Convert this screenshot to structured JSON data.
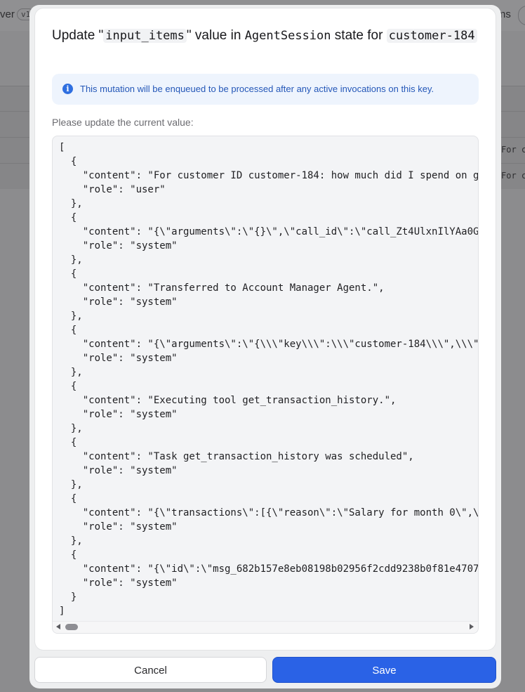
{
  "background": {
    "top_left_text": "ver",
    "version_badge": "v1",
    "top_right_text": "ns",
    "row_cells": [
      "For c",
      "For c"
    ]
  },
  "dialog": {
    "title_prefix": "Update \"",
    "key_name": "input_items",
    "title_mid": "\" value in",
    "entity": "AgentSession",
    "title_suffix": "state for",
    "key_value": "customer-184",
    "info_text": "This mutation will be enqueued to be processed after any active invocations on this key.",
    "field_label": "Please update the current value:",
    "editor_value": "[\n  {\n    \"content\": \"For customer ID customer-184: how much did I spend on ga\n    \"role\": \"user\"\n  },\n  {\n    \"content\": \"{\\\"arguments\\\":\\\"{}\\\",\\\"call_id\\\":\\\"call_Zt4UlxnIlYAa0G\n    \"role\": \"system\"\n  },\n  {\n    \"content\": \"Transferred to Account Manager Agent.\",\n    \"role\": \"system\"\n  },\n  {\n    \"content\": \"{\\\"arguments\\\":\\\"{\\\\\\\"key\\\\\\\":\\\\\\\"customer-184\\\\\\\",\\\\\\\"\n    \"role\": \"system\"\n  },\n  {\n    \"content\": \"Executing tool get_transaction_history.\",\n    \"role\": \"system\"\n  },\n  {\n    \"content\": \"Task get_transaction_history was scheduled\",\n    \"role\": \"system\"\n  },\n  {\n    \"content\": \"{\\\"transactions\\\":[{\\\"reason\\\":\\\"Salary for month 0\\\",\\\n    \"role\": \"system\"\n  },\n  {\n    \"content\": \"{\\\"id\\\":\\\"msg_682b157e8eb08198b02956f2cdd9238b0f81e4707\n    \"role\": \"system\"\n  }\n]",
    "cancel_label": "Cancel",
    "save_label": "Save"
  },
  "colors": {
    "primary": "#2a62e6",
    "info_background": "#eef4fd",
    "info_text": "#2457b8",
    "overlay": "#8c8c8e"
  },
  "icons": {
    "info": "info-circle-icon",
    "scroll_left": "chevron-left-icon",
    "scroll_right": "chevron-right-icon"
  }
}
